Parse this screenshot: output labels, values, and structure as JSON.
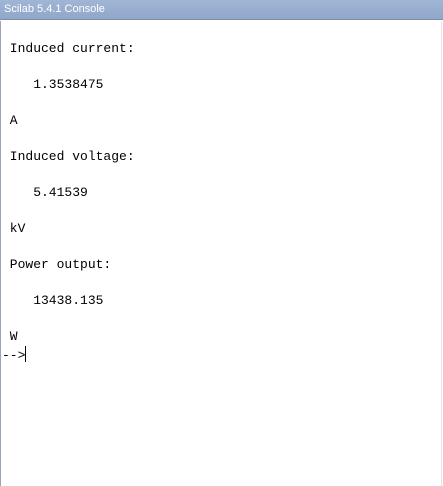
{
  "window": {
    "title": "Scilab 5.4.1 Console"
  },
  "console": {
    "lines": [
      " Induced current:",
      "",
      "    1.3538475",
      "",
      " A",
      "",
      " Induced voltage:",
      "",
      "    5.41539",
      "",
      " kV",
      "",
      " Power output:",
      "",
      "    13438.135",
      "",
      " W"
    ],
    "prompt": "-->"
  }
}
